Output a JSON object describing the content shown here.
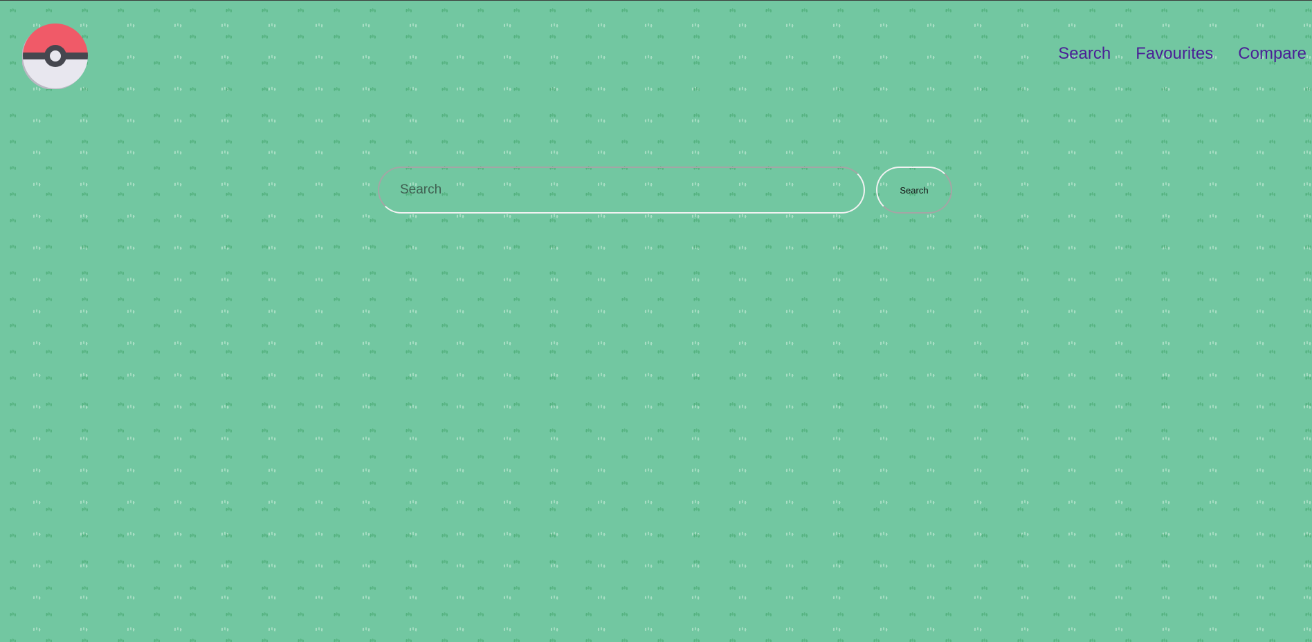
{
  "header": {
    "logo": {
      "icon": "pokeball-icon",
      "colors": {
        "top": "#f05a68",
        "bottom": "#e8e7ef",
        "band": "#46474f"
      }
    },
    "nav": [
      {
        "label": "Search"
      },
      {
        "label": "Favourites"
      },
      {
        "label": "Compare"
      }
    ],
    "nav_color": "#4a1f96"
  },
  "search": {
    "placeholder": "Search",
    "value": "",
    "button_label": "Search"
  },
  "theme": {
    "background": "#72c7a1"
  }
}
